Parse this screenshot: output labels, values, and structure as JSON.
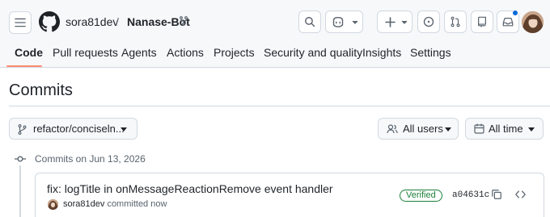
{
  "header": {
    "owner": "sora81dev",
    "separator": "/",
    "repo": "Nanase-Bot"
  },
  "tabs": [
    {
      "label": "Code",
      "active": true
    },
    {
      "label": "Pull requests"
    },
    {
      "label": "Agents"
    },
    {
      "label": "Actions"
    },
    {
      "label": "Projects"
    },
    {
      "label": "Security and quality"
    },
    {
      "label": "Insights"
    },
    {
      "label": "Settings"
    }
  ],
  "page": {
    "title": "Commits"
  },
  "filters": {
    "branch": "refactor/conciseln...",
    "users": "All users",
    "time": "All time"
  },
  "commits": {
    "group_label": "Commits on Jun 13, 2026",
    "items": [
      {
        "title": "fix: logTitle in onMessageReactionRemove event handler",
        "author": "sora81dev",
        "when": "committed now",
        "verified": "Verified",
        "sha": "a04631c"
      }
    ]
  },
  "colors": {
    "accent_underline": "#fd8c73",
    "notification_dot": "#0969da",
    "verified": "#1a7f37"
  }
}
